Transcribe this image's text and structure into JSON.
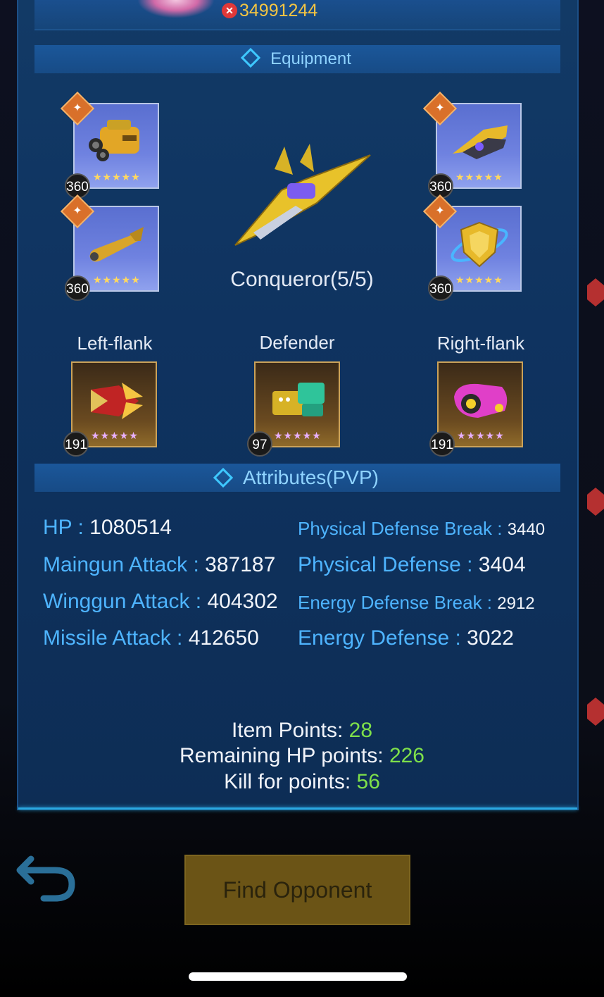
{
  "header": {
    "power_value": "34991244"
  },
  "equipment": {
    "title": "Equipment",
    "slots": [
      {
        "level": "360",
        "stars": "★★★★★"
      },
      {
        "level": "360",
        "stars": "★★★★★"
      },
      {
        "level": "360",
        "stars": "★★★★★"
      },
      {
        "level": "360",
        "stars": "★★★★★"
      }
    ],
    "ship_name": "Conqueror(5/5)",
    "companions": [
      {
        "label": "Left-flank",
        "level": "191",
        "stars": "★★★★★"
      },
      {
        "label": "Defender",
        "level": "97",
        "stars": "★★★★★"
      },
      {
        "label": "Right-flank",
        "level": "191",
        "stars": "★★★★★"
      }
    ]
  },
  "attributes": {
    "title": "Attributes(PVP)",
    "left": [
      {
        "label": "HP : ",
        "value": "1080514"
      },
      {
        "label": "Maingun Attack : ",
        "value": "387187"
      },
      {
        "label": "Winggun Attack : ",
        "value": "404302"
      },
      {
        "label": "Missile Attack : ",
        "value": "412650"
      }
    ],
    "right": [
      {
        "label": "Physical Defense Break : ",
        "value": "3440"
      },
      {
        "label": "Physical Defense : ",
        "value": "3404"
      },
      {
        "label": "Energy Defense Break : ",
        "value": "2912"
      },
      {
        "label": "Energy Defense : ",
        "value": "3022"
      }
    ]
  },
  "points": {
    "item_label": "Item Points: ",
    "item_value": "28",
    "hp_label": "Remaining HP points: ",
    "hp_value": "226",
    "kill_label": "Kill for points: ",
    "kill_value": "56"
  },
  "actions": {
    "find_opponent": "Find Opponent"
  },
  "colors": {
    "accent": "#4eb4ff",
    "gold": "#f5c542",
    "green": "#7ee04a"
  }
}
